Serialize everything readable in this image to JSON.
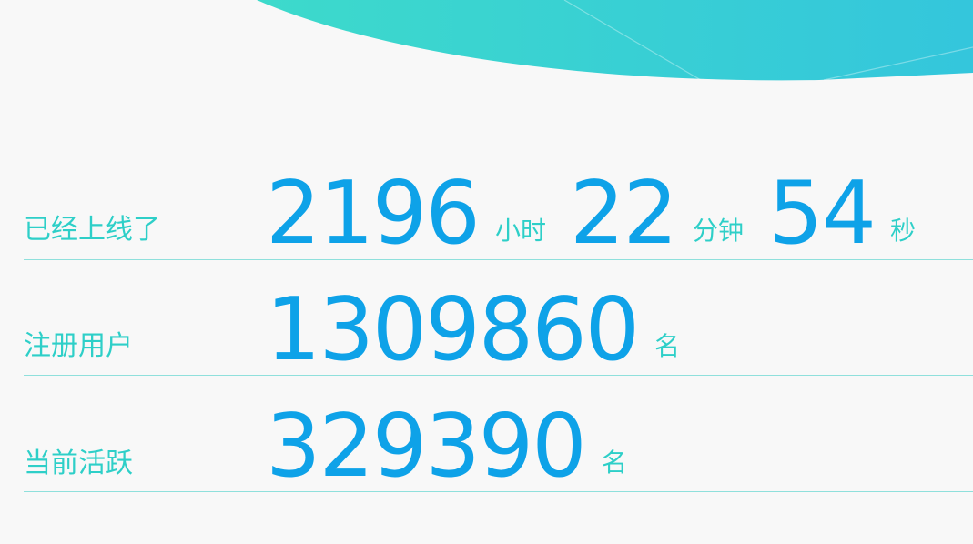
{
  "online": {
    "label": "已经上线了",
    "hours": "2196",
    "hours_unit": "小时",
    "minutes": "22",
    "minutes_unit": "分钟",
    "seconds": "54",
    "seconds_unit": "秒"
  },
  "registered": {
    "label": "注册用户",
    "value": "1309860",
    "unit": "名"
  },
  "active": {
    "label": "当前活跃",
    "value": "329390",
    "unit": "名"
  },
  "colors": {
    "background": "#f8f8f8",
    "label_teal": "#2ecfc8",
    "number_blue": "#0ea2e8",
    "divider": "#8fe0dc",
    "banner_start": "#3ddacb",
    "banner_end": "#34c6dc"
  }
}
